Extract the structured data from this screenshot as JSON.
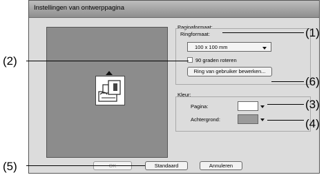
{
  "dialog": {
    "title": "Instellingen van ontwerppagina",
    "paginaformaat": {
      "group_label": "Paginaformaat:",
      "ringformaat_label": "Ringformaat:",
      "ringformaat_value": "100 x 100 mm",
      "rotate_label": "90 graden roteren",
      "rotate_checked": false,
      "edit_button": "Ring van gebruiker bewerken..."
    },
    "kleur": {
      "group_label": "Kleur:",
      "pagina_label": "Pagina:",
      "pagina_color": "#ffffff",
      "achtergrond_label": "Achtergrond:",
      "achtergrond_color": "#9a9a9a"
    },
    "buttons": {
      "ok": "OK",
      "standaard": "Standaard",
      "annuleren": "Annuleren"
    }
  },
  "callouts": [
    "(1)",
    "(2)",
    "(3)",
    "(4)",
    "(5)",
    "(6)"
  ]
}
